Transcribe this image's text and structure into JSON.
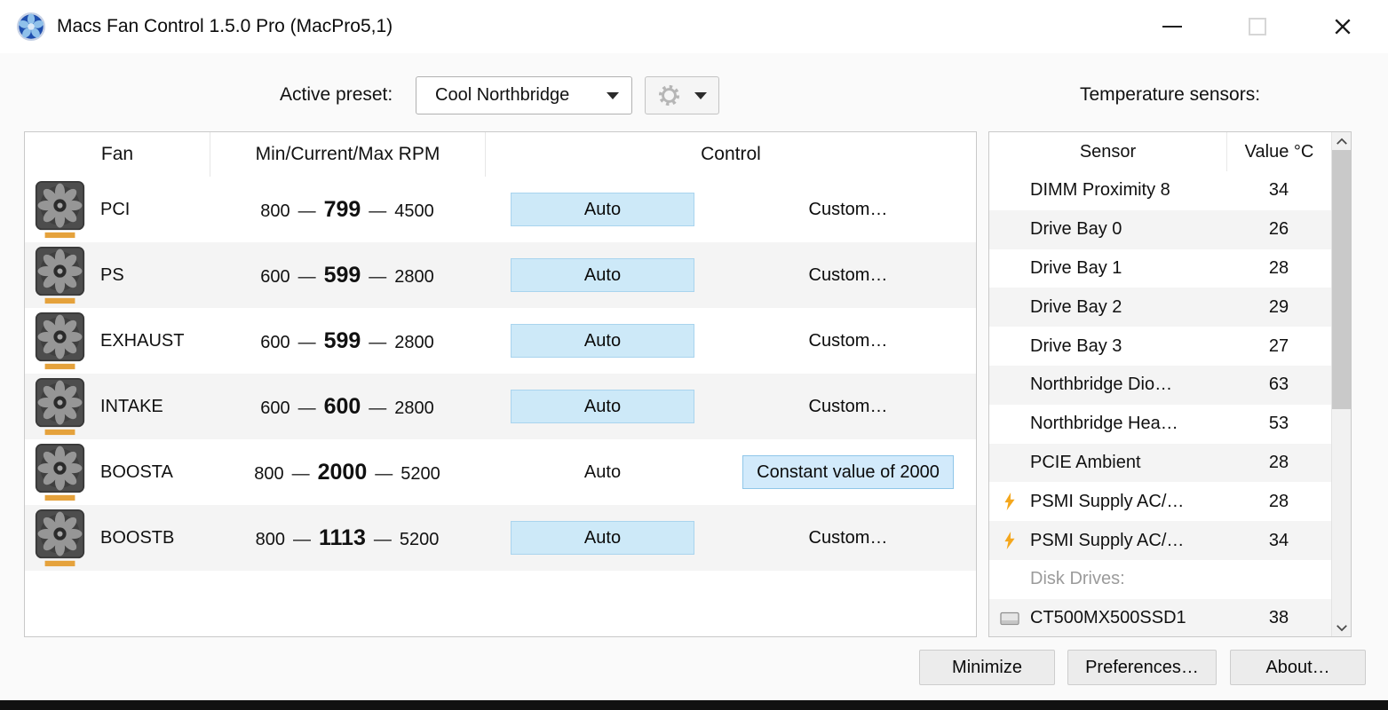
{
  "window": {
    "title": "Macs Fan Control 1.5.0 Pro (MacPro5,1)"
  },
  "toolbar": {
    "preset_label": "Active preset:",
    "preset_value": "Cool Northbridge",
    "sensors_label": "Temperature sensors:"
  },
  "fan_table": {
    "headers": {
      "fan": "Fan",
      "rpm": "Min/Current/Max RPM",
      "control": "Control"
    },
    "rpm_separator": "—",
    "rows": [
      {
        "name": "PCI",
        "min": "800",
        "current": "799",
        "max": "4500",
        "auto": "Auto",
        "control": "Custom…",
        "control_type": "custom"
      },
      {
        "name": "PS",
        "min": "600",
        "current": "599",
        "max": "2800",
        "auto": "Auto",
        "control": "Custom…",
        "control_type": "custom"
      },
      {
        "name": "EXHAUST",
        "min": "600",
        "current": "599",
        "max": "2800",
        "auto": "Auto",
        "control": "Custom…",
        "control_type": "custom"
      },
      {
        "name": "INTAKE",
        "min": "600",
        "current": "600",
        "max": "2800",
        "auto": "Auto",
        "control": "Custom…",
        "control_type": "custom"
      },
      {
        "name": "BOOSTA",
        "min": "800",
        "current": "2000",
        "max": "5200",
        "auto": "Auto",
        "control": "Constant value of 2000",
        "control_type": "constant"
      },
      {
        "name": "BOOSTB",
        "min": "800",
        "current": "1113",
        "max": "5200",
        "auto": "Auto",
        "control": "Custom…",
        "control_type": "custom"
      }
    ]
  },
  "sensor_table": {
    "headers": {
      "sensor": "Sensor",
      "value": "Value °C"
    },
    "rows": [
      {
        "name": "DIMM Proximity 8",
        "value": "34",
        "icon": "none"
      },
      {
        "name": "Drive Bay 0",
        "value": "26",
        "icon": "none"
      },
      {
        "name": "Drive Bay 1",
        "value": "28",
        "icon": "none"
      },
      {
        "name": "Drive Bay 2",
        "value": "29",
        "icon": "none"
      },
      {
        "name": "Drive Bay 3",
        "value": "27",
        "icon": "none"
      },
      {
        "name": "Northbridge Dio…",
        "value": "63",
        "icon": "none"
      },
      {
        "name": "Northbridge Hea…",
        "value": "53",
        "icon": "none"
      },
      {
        "name": "PCIE Ambient",
        "value": "28",
        "icon": "none"
      },
      {
        "name": "PSMI Supply AC/…",
        "value": "28",
        "icon": "lightning"
      },
      {
        "name": "PSMI Supply AC/…",
        "value": "34",
        "icon": "lightning"
      },
      {
        "name": "Disk Drives:",
        "value": "",
        "icon": "none",
        "group": true
      },
      {
        "name": "CT500MX500SSD1",
        "value": "38",
        "icon": "disk"
      }
    ]
  },
  "footer": {
    "minimize": "Minimize",
    "preferences": "Preferences…",
    "about": "About…"
  },
  "icons": {
    "app_icon": "blue-fan-logo",
    "gear_icon": "gear",
    "dropdown_arrow": "triangle-down",
    "fan_icon": "fan-with-orange-base",
    "lightning_icon": "orange-bolt",
    "disk_icon": "gray-drive",
    "scroll_up": "chevron-up",
    "scroll_down": "chevron-down",
    "minimize_icon": "line",
    "maximize_icon": "box",
    "close_icon": "x"
  },
  "colors": {
    "auto_button_bg": "#cde9f8",
    "auto_button_border": "#a9d4ee",
    "constant_button_bg": "#d2eafb",
    "constant_button_border": "#8fc6e9",
    "row_alt_bg": "#f4f4f4",
    "fan_icon_base": "#e5a23c",
    "lightning": "#f4a71d",
    "bottom_strip": "#111111"
  }
}
